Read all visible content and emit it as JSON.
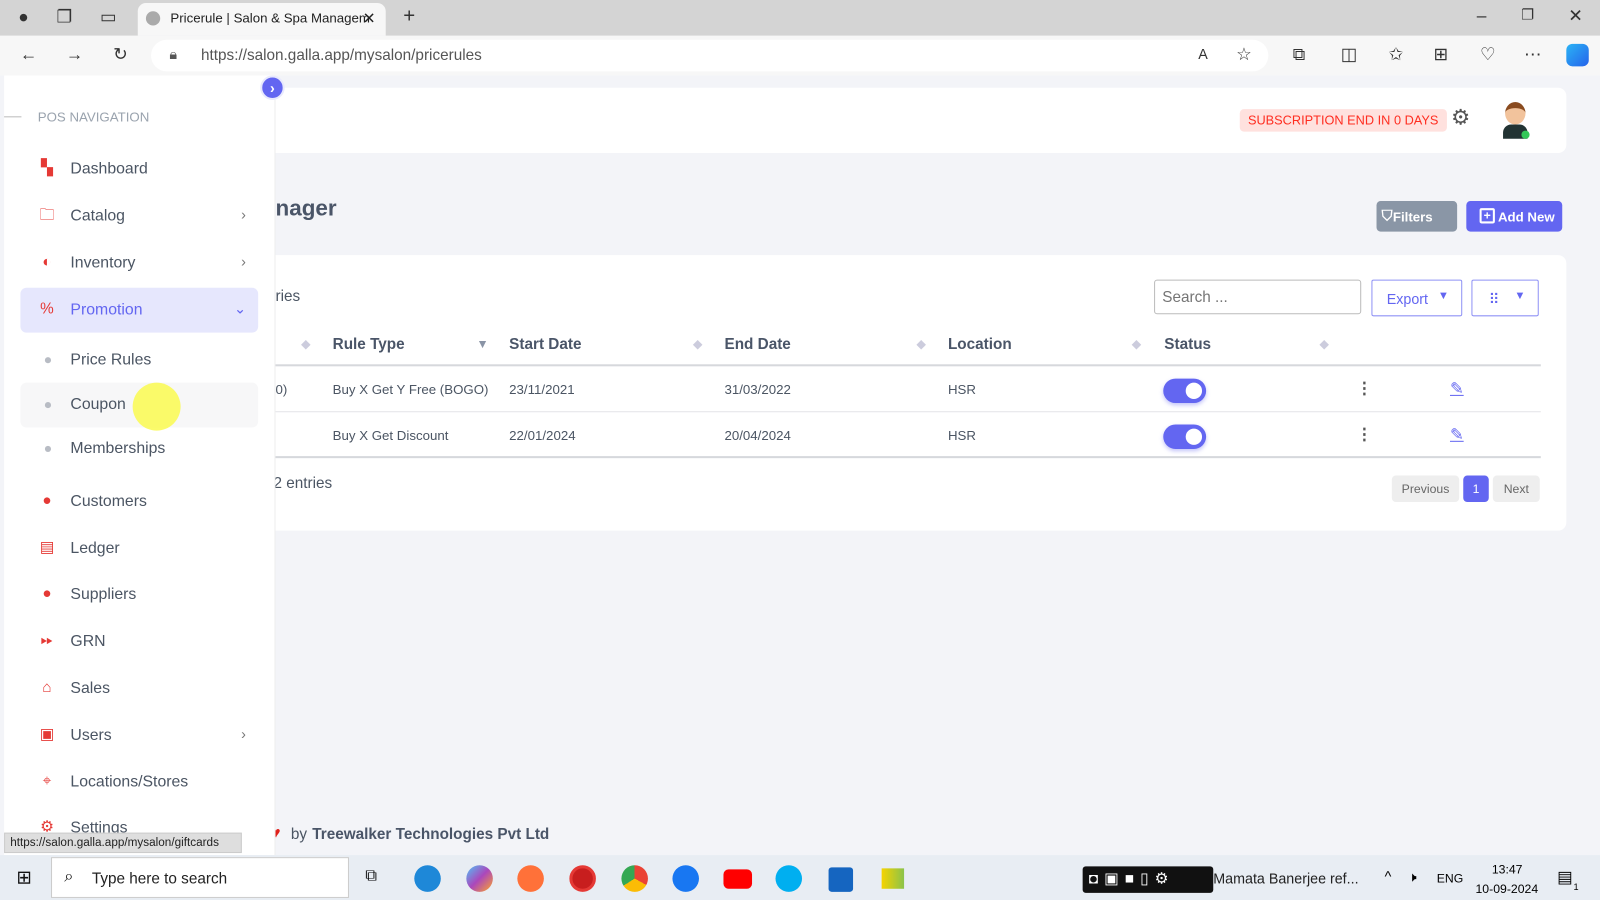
{
  "browser": {
    "tab_title": "Pricerule | Salon & Spa Managem",
    "url": "https://salon.galla.app/mysalon/pricerules",
    "status_url": "https://salon.galla.app/mysalon/giftcards"
  },
  "sidebar": {
    "heading": "POS NAVIGATION",
    "items": [
      {
        "label": "Dashboard",
        "icon": "dashboard-icon"
      },
      {
        "label": "Catalog",
        "icon": "folder-icon",
        "chevron": true
      },
      {
        "label": "Inventory",
        "icon": "inventory-icon",
        "chevron": true
      },
      {
        "label": "Promotion",
        "icon": "ticket-icon",
        "active": true
      },
      {
        "label": "Price Rules",
        "sub": true
      },
      {
        "label": "Coupon",
        "sub": true,
        "hover": true
      },
      {
        "label": "Memberships",
        "sub": true
      },
      {
        "label": "Customers",
        "icon": "user-icon"
      },
      {
        "label": "Ledger",
        "icon": "document-icon"
      },
      {
        "label": "Suppliers",
        "icon": "user-icon"
      },
      {
        "label": "GRN",
        "icon": "forward-icon"
      },
      {
        "label": "Sales",
        "icon": "basket-icon"
      },
      {
        "label": "Users",
        "icon": "users-icon",
        "chevron": true
      },
      {
        "label": "Locations/Stores",
        "icon": "location-icon"
      },
      {
        "label": "Settings",
        "icon": "gear-icon"
      }
    ]
  },
  "header": {
    "subscription": "SUBSCRIPTION END IN 0 DAYS"
  },
  "page": {
    "title_partial": "nager",
    "filters": "Filters",
    "add_new": "Add New",
    "show_entries_partial": "ries",
    "search_placeholder": "Search ...",
    "export": "Export"
  },
  "table": {
    "columns": [
      "Rule Type",
      "Start Date",
      "End Date",
      "Location",
      "Status"
    ],
    "rows": [
      {
        "name_partial": "0)",
        "rule_type": "Buy X Get Y Free (BOGO)",
        "start": "23/11/2021",
        "end": "31/03/2022",
        "location": "HSR",
        "status": true
      },
      {
        "name_partial": "",
        "rule_type": "Buy X Get Discount",
        "start": "22/01/2024",
        "end": "20/04/2024",
        "location": "HSR",
        "status": true
      }
    ],
    "info_partial": "2 entries",
    "pagination": {
      "prev": "Previous",
      "current": "1",
      "next": "Next"
    }
  },
  "footer": {
    "by": "by",
    "company": "Treewalker Technologies Pvt Ltd"
  },
  "taskbar": {
    "search": "Type here to search",
    "news": "Mamata Banerjee ref...",
    "lang": "ENG",
    "time": "13:47",
    "date": "10-09-2024",
    "notif": "1"
  },
  "colors": {
    "accent": "#6366f1",
    "icon_red": "#e53935",
    "badge_text": "#ff2d20",
    "badge_bg": "#ffe1de"
  }
}
